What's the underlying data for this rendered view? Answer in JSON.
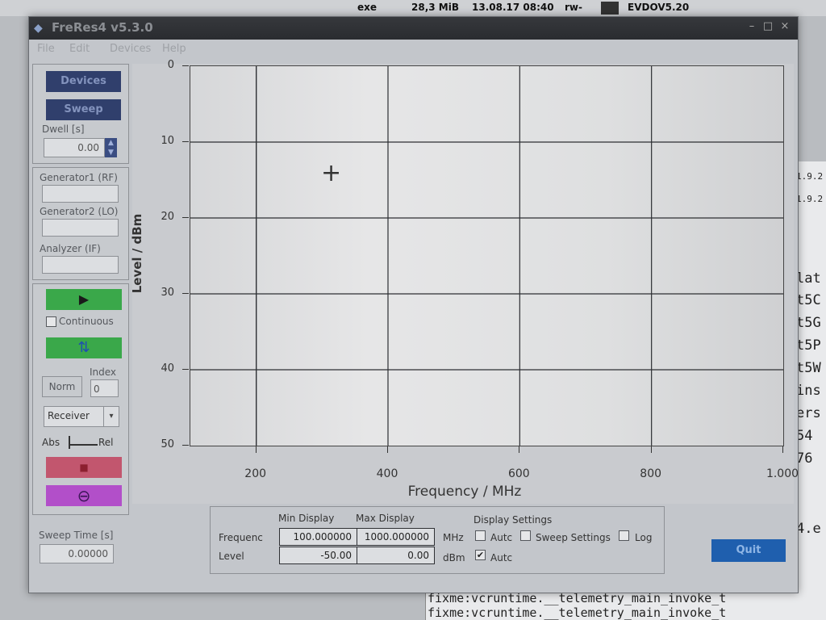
{
  "taskbar": {
    "col_exe": "exe",
    "col_size": "28,3 MiB",
    "col_date": "13.08.17 08:40",
    "col_perm": "rw-",
    "app": "EVDOV5.20"
  },
  "background_text": {
    "right_lines": [
      "1.9.2",
      "1.9.2",
      "lat",
      "t5C",
      "t5G",
      "t5P",
      "t5W",
      "ins",
      "ers",
      "54 ",
      "76 ",
      "4.e"
    ],
    "bottom_lines": [
      "fixme:vcruntime.__telemetry_main_invoke_t",
      "fixme:vcruntime.__telemetry_main_invoke_t"
    ]
  },
  "window": {
    "title": "FreRes4 v5.3.0",
    "menu": [
      "File",
      "Edit",
      "Devices",
      "Help"
    ],
    "controls": {
      "minimize": "–",
      "maximize": "□",
      "close": "×"
    }
  },
  "left_panel": {
    "devices_label": "Devices",
    "sweep_label": "Sweep",
    "dwell_label": "Dwell [s]",
    "dwell_value": "0.00",
    "gen1_label": "Generator1 (RF)",
    "gen2_label": "Generator2 (LO)",
    "analyzer_label": "Analyzer (IF)",
    "continuous_label": "Continuous",
    "index_label": "Index",
    "index_value": "0",
    "norm_label": "Norm",
    "mode_value": "Receiver",
    "abs_label": "Abs",
    "rel_label": "Rel",
    "sweep_time_label": "Sweep Time [s]",
    "sweep_time_value": "0.00000"
  },
  "chart_data": {
    "type": "line",
    "series": [],
    "xlabel": "Frequency / MHz",
    "ylabel": "Level / dBm",
    "xlim": [
      100,
      1000
    ],
    "ylim": [
      0,
      50
    ],
    "y_inverted": true,
    "x_ticks": [
      200,
      400,
      600,
      800,
      1000
    ],
    "x_tick_labels": [
      "200",
      "400",
      "600",
      "800",
      "1.000"
    ],
    "y_ticks": [
      0,
      10,
      20,
      30,
      40,
      50
    ],
    "y_tick_labels": [
      "0",
      "10",
      "20",
      "30",
      "40",
      "50"
    ],
    "grid": true
  },
  "display": {
    "min_header": "Min Display",
    "max_header": "Max Display",
    "settings_header": "Display Settings",
    "freq_label": "Frequenc",
    "level_label": "Level",
    "freq_min": "100.000000",
    "freq_max": "1000.000000",
    "freq_unit": "MHz",
    "level_min": "-50.00",
    "level_max": "0.00",
    "level_unit": "dBm",
    "auto_freq_label": "Autc",
    "auto_level_label": "Autc",
    "sweep_settings_label": "Sweep Settings",
    "log_label": "Log"
  },
  "quit_label": "Quit",
  "colors": {
    "nav_button": "#303f6c",
    "start_button": "#3aa84a",
    "stop_button": "#c2566e",
    "clear_button": "#b24fc9",
    "quit_button": "#1f5fae"
  }
}
